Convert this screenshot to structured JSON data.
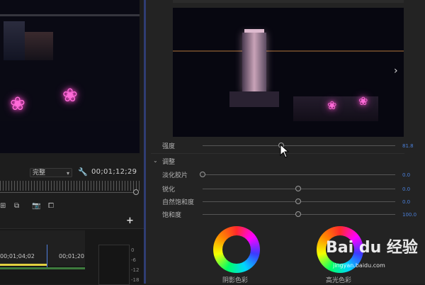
{
  "program_monitor": {
    "quality": "完整",
    "timecode": "00;01;12;29"
  },
  "timeline": {
    "timecode_a": "00;01;04;02",
    "timecode_b": "00;01;20",
    "meter_ticks": [
      "0",
      "-6",
      "-12",
      "-18"
    ]
  },
  "effect_controls": {
    "intensity_label": "强度",
    "intensity_value": "81.8",
    "section_label": "调整",
    "params": [
      {
        "label": "淡化胶片",
        "value": "0.0",
        "level": 0.0
      },
      {
        "label": "锐化",
        "value": "0.0",
        "level": 0.5
      },
      {
        "label": "自然饱和度",
        "value": "0.0",
        "level": 0.5
      },
      {
        "label": "饱和度",
        "value": "100.0",
        "level": 0.5
      }
    ],
    "intensity_level": 0.41,
    "wheels": [
      {
        "label": "阴影色彩"
      },
      {
        "label": "高光色彩"
      }
    ]
  },
  "watermark": {
    "brand": "Bai du 经验",
    "url": "jingyan.baidu.com"
  },
  "colors": {
    "accent": "#4a7fd9",
    "divider": "#2f3d73",
    "playhead": "#e2d140"
  },
  "icons": [
    "wrench-icon",
    "export-frame-icon",
    "camera-icon",
    "insert-icon",
    "chevron-down-icon",
    "chevron-right-icon",
    "plus-icon",
    "mouse-cursor-icon"
  ]
}
